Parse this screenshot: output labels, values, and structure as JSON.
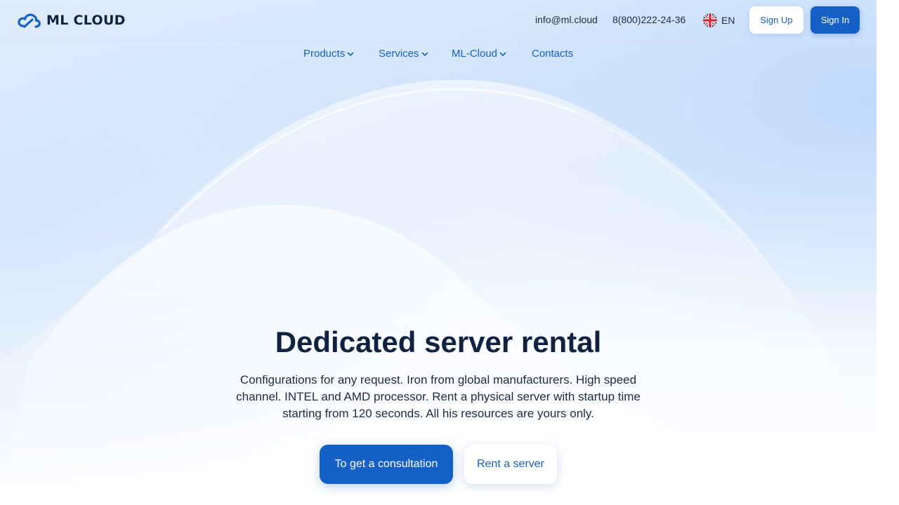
{
  "brand": {
    "name": "ML CLOUD",
    "logo_icon": "cloud-logo-icon",
    "accent_color": "#1560c6"
  },
  "header": {
    "email": "info@ml.cloud",
    "phone": "8(800)222-24-36",
    "language": {
      "code": "EN",
      "icon": "uk-flag-icon"
    },
    "sign_up_label": "Sign Up",
    "sign_in_label": "Sign In"
  },
  "nav": {
    "items": [
      {
        "label": "Products",
        "has_dropdown": true
      },
      {
        "label": "Services",
        "has_dropdown": true
      },
      {
        "label": "ML-Cloud",
        "has_dropdown": true
      },
      {
        "label": "Contacts",
        "has_dropdown": false
      }
    ]
  },
  "hero": {
    "title": "Dedicated server rental",
    "description": "Configurations for any request. Iron from global manufacturers. High speed channel. INTEL and AMD processor. Rent a physical server with startup time starting from 120 seconds. All his resources are yours only.",
    "primary_button": "To get a consultation",
    "secondary_button": "Rent a server"
  }
}
